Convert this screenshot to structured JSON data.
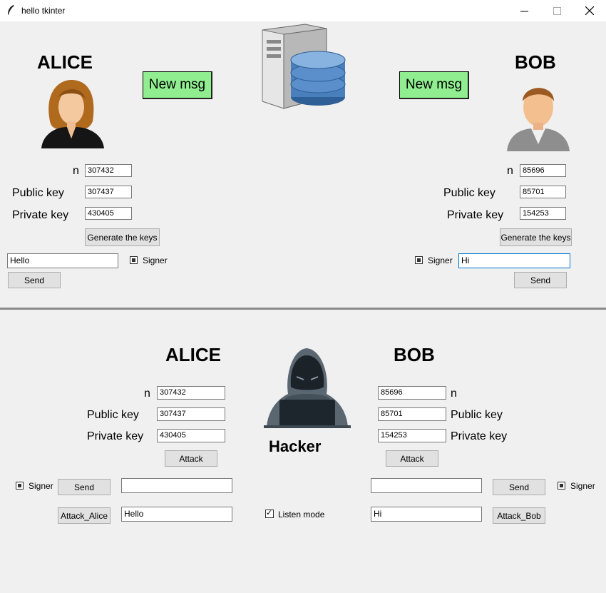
{
  "window": {
    "title": "hello tkinter",
    "controls": [
      "minimize-icon",
      "maximize-icon",
      "close-icon"
    ]
  },
  "top": {
    "alice": {
      "title": "ALICE",
      "new_msg": "New msg",
      "n_label": "n",
      "n_value": "307432",
      "pub_label": "Public key",
      "pub_value": "307437",
      "priv_label": "Private key",
      "priv_value": "430405",
      "gen_label": "Generate the keys",
      "message": "Hello",
      "signer_label": "Signer",
      "send_label": "Send"
    },
    "bob": {
      "title": "BOB",
      "new_msg": "New msg",
      "n_label": "n",
      "n_value": "85696",
      "pub_label": "Public key",
      "pub_value": "85701",
      "priv_label": "Private key",
      "priv_value": "154253",
      "gen_label": "Generate the keys",
      "message": "Hi",
      "signer_label": "Signer",
      "send_label": "Send"
    }
  },
  "bottom": {
    "hacker_label": "Hacker",
    "alice": {
      "title": "ALICE",
      "n_label": "n",
      "n_value": "307432",
      "pub_label": "Public key",
      "pub_value": "307437",
      "priv_label": "Private key",
      "priv_value": "430405",
      "attack_label": "Attack",
      "signer_label": "Signer",
      "send_label": "Send",
      "send_input": "",
      "attack_btn": "Attack_Alice",
      "intercepted": "Hello"
    },
    "bob": {
      "title": "BOB",
      "n_label": "n",
      "n_value": "85696",
      "pub_label": "Public key",
      "pub_value": "85701",
      "priv_label": "Private key",
      "priv_value": "154253",
      "attack_label": "Attack",
      "signer_label": "Signer",
      "send_label": "Send",
      "send_input": "",
      "attack_btn": "Attack_Bob",
      "intercepted": "Hi"
    },
    "listen_label": "Listen mode"
  },
  "colors": {
    "new_msg_bg": "#90ee90",
    "background": "#f0f0f0",
    "divider": "#8a8a8a"
  }
}
